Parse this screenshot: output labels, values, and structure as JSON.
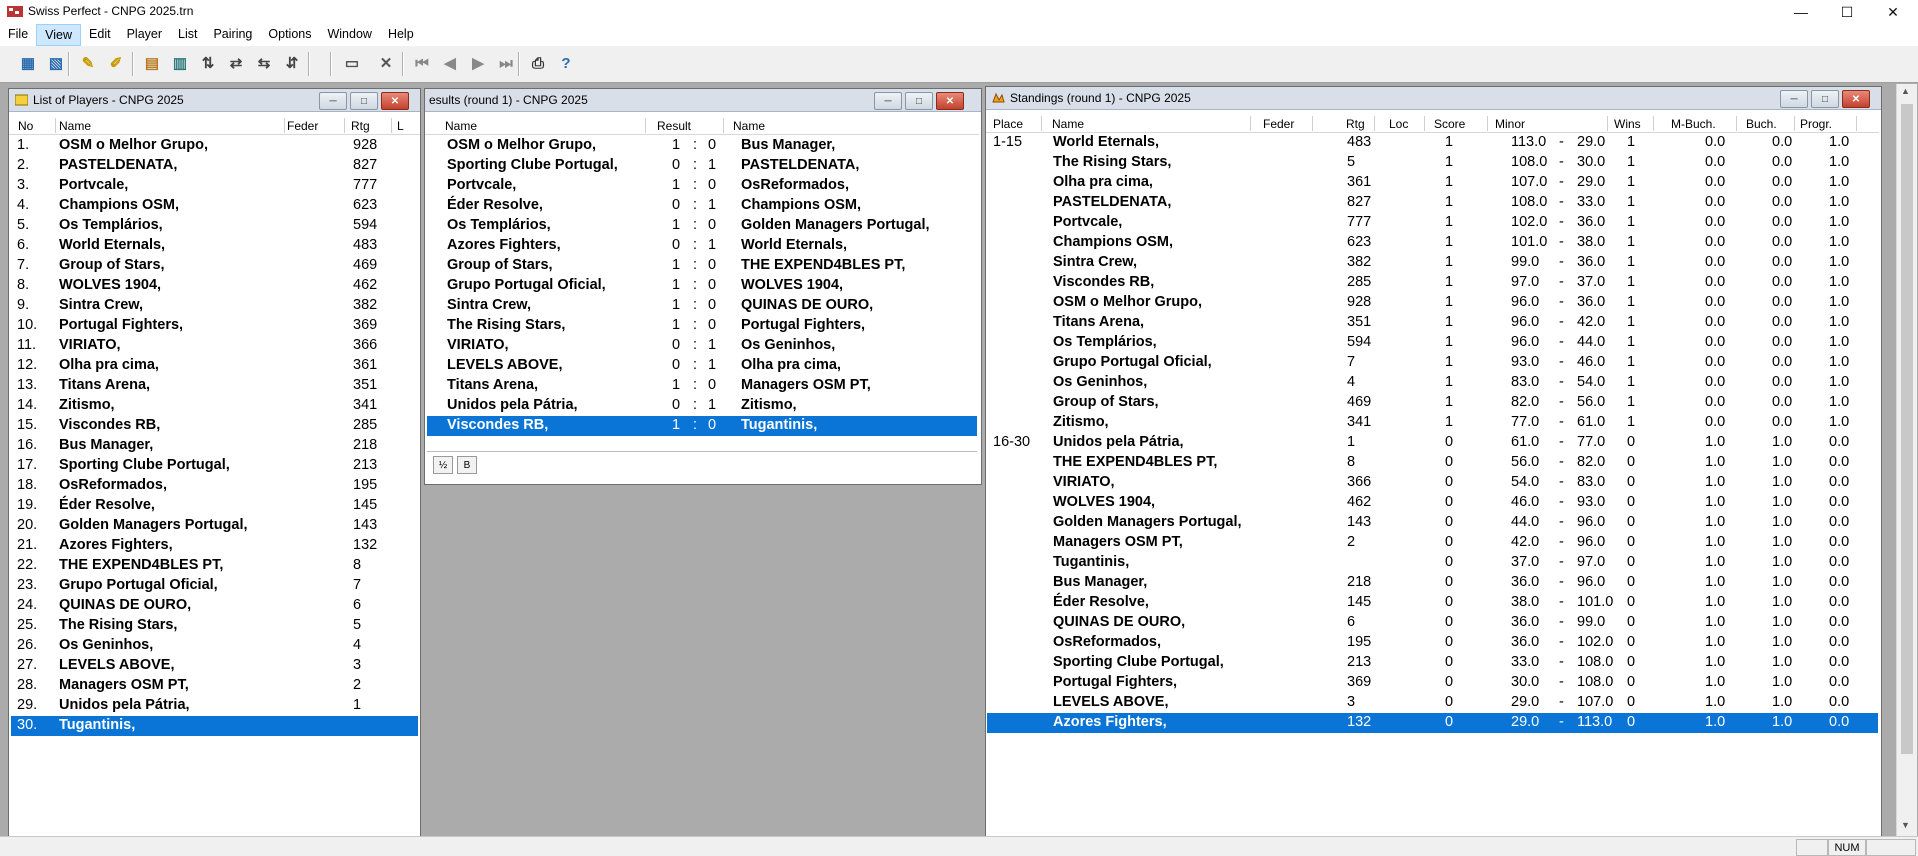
{
  "app": {
    "title": "Swiss Perfect - CNPG 2025.trn",
    "menu": [
      "File",
      "View",
      "Edit",
      "Player",
      "List",
      "Pairing",
      "Options",
      "Window",
      "Help"
    ],
    "active_menu": "View",
    "toolbar_icons": [
      "new-tournament-icon",
      "open-tournament-icon",
      "edit-player-icon",
      "withdraw-player-icon",
      "player-list-icon",
      "standings-icon",
      "round-icon",
      "pair-icon",
      "swap-icon",
      "numbering-icon",
      "crosstable-icon",
      "report-icon",
      "tie-break-icon",
      "delete-pairing-icon",
      "first-round-icon",
      "previous-round-icon",
      "next-round-icon",
      "last-round-icon",
      "print-icon",
      "help-icon"
    ],
    "accent": "#0a75d6"
  },
  "players_window": {
    "title": "List of Players - CNPG 2025",
    "headers": {
      "no": "No",
      "name": "Name",
      "feder": "Feder",
      "rtg": "Rtg",
      "l": "L"
    },
    "rows": [
      {
        "no": "1.",
        "name": "OSM o Melhor Grupo,",
        "rtg": "928"
      },
      {
        "no": "2.",
        "name": "PASTELDENATA,",
        "rtg": "827"
      },
      {
        "no": "3.",
        "name": "Portvcale,",
        "rtg": "777"
      },
      {
        "no": "4.",
        "name": "Champions OSM,",
        "rtg": "623"
      },
      {
        "no": "5.",
        "name": "Os Templários,",
        "rtg": "594"
      },
      {
        "no": "6.",
        "name": "World Eternals,",
        "rtg": "483"
      },
      {
        "no": "7.",
        "name": "Group of Stars,",
        "rtg": "469"
      },
      {
        "no": "8.",
        "name": "WOLVES 1904,",
        "rtg": "462"
      },
      {
        "no": "9.",
        "name": "Sintra Crew,",
        "rtg": "382"
      },
      {
        "no": "10.",
        "name": "Portugal Fighters,",
        "rtg": "369"
      },
      {
        "no": "11.",
        "name": "VIRIATO,",
        "rtg": "366"
      },
      {
        "no": "12.",
        "name": "Olha pra cima,",
        "rtg": "361"
      },
      {
        "no": "13.",
        "name": "Titans Arena,",
        "rtg": "351"
      },
      {
        "no": "14.",
        "name": "Zitismo,",
        "rtg": "341"
      },
      {
        "no": "15.",
        "name": "Viscondes RB,",
        "rtg": "285"
      },
      {
        "no": "16.",
        "name": "Bus Manager,",
        "rtg": "218"
      },
      {
        "no": "17.",
        "name": "Sporting Clube Portugal,",
        "rtg": "213"
      },
      {
        "no": "18.",
        "name": "OsReformados,",
        "rtg": "195"
      },
      {
        "no": "19.",
        "name": "Éder Resolve,",
        "rtg": "145"
      },
      {
        "no": "20.",
        "name": "Golden Managers Portugal,",
        "rtg": "143"
      },
      {
        "no": "21.",
        "name": "Azores Fighters,",
        "rtg": "132"
      },
      {
        "no": "22.",
        "name": "THE EXPEND4BLES PT,",
        "rtg": "8"
      },
      {
        "no": "23.",
        "name": "Grupo Portugal Oficial,",
        "rtg": "7"
      },
      {
        "no": "24.",
        "name": "QUINAS DE OURO,",
        "rtg": "6"
      },
      {
        "no": "25.",
        "name": "The Rising Stars,",
        "rtg": "5"
      },
      {
        "no": "26.",
        "name": "Os Geninhos,",
        "rtg": "4"
      },
      {
        "no": "27.",
        "name": "LEVELS ABOVE,",
        "rtg": "3"
      },
      {
        "no": "28.",
        "name": "Managers OSM PT,",
        "rtg": "2"
      },
      {
        "no": "29.",
        "name": "Unidos pela Pátria,",
        "rtg": "1"
      },
      {
        "no": "30.",
        "name": "Tugantinis,",
        "rtg": ""
      }
    ]
  },
  "results_window": {
    "title": "esults  (round 1) - CNPG 2025",
    "headers": {
      "name": "Name",
      "result": "Result",
      "name2": "Name"
    },
    "rows": [
      {
        "white": "OSM o Melhor Grupo,",
        "w": "1",
        "sep": ":",
        "b": "0",
        "black": "Bus Manager,"
      },
      {
        "white": "Sporting Clube Portugal,",
        "w": "0",
        "sep": ":",
        "b": "1",
        "black": "PASTELDENATA,"
      },
      {
        "white": "Portvcale,",
        "w": "1",
        "sep": ":",
        "b": "0",
        "black": "OsReformados,"
      },
      {
        "white": "Éder Resolve,",
        "w": "0",
        "sep": ":",
        "b": "1",
        "black": "Champions OSM,"
      },
      {
        "white": "Os Templários,",
        "w": "1",
        "sep": ":",
        "b": "0",
        "black": "Golden Managers Portugal,"
      },
      {
        "white": "Azores Fighters,",
        "w": "0",
        "sep": ":",
        "b": "1",
        "black": "World Eternals,"
      },
      {
        "white": "Group of Stars,",
        "w": "1",
        "sep": ":",
        "b": "0",
        "black": "THE EXPEND4BLES PT,"
      },
      {
        "white": "Grupo Portugal Oficial,",
        "w": "1",
        "sep": ":",
        "b": "0",
        "black": "WOLVES 1904,"
      },
      {
        "white": "Sintra Crew,",
        "w": "1",
        "sep": ":",
        "b": "0",
        "black": "QUINAS DE OURO,"
      },
      {
        "white": "The Rising Stars,",
        "w": "1",
        "sep": ":",
        "b": "0",
        "black": "Portugal Fighters,"
      },
      {
        "white": "VIRIATO,",
        "w": "0",
        "sep": ":",
        "b": "1",
        "black": "Os Geninhos,"
      },
      {
        "white": "LEVELS ABOVE,",
        "w": "0",
        "sep": ":",
        "b": "1",
        "black": "Olha pra cima,"
      },
      {
        "white": "Titans Arena,",
        "w": "1",
        "sep": ":",
        "b": "0",
        "black": "Managers OSM PT,"
      },
      {
        "white": "Unidos pela Pátria,",
        "w": "0",
        "sep": ":",
        "b": "1",
        "black": "Zitismo,"
      },
      {
        "white": "Viscondes RB,",
        "w": "1",
        "sep": ":",
        "b": "0",
        "black": "Tugantinis,"
      }
    ],
    "footer_buttons": [
      "½",
      "B"
    ]
  },
  "standings_window": {
    "title": "Standings  (round 1) - CNPG 2025",
    "headers": {
      "place": "Place",
      "name": "Name",
      "feder": "Feder",
      "rtg": "Rtg",
      "loc": "Loc",
      "score": "Score",
      "minor": "Minor",
      "wins": "Wins",
      "mbuch": "M-Buch.",
      "buch": "Buch.",
      "progr": "Progr."
    },
    "rows": [
      {
        "place": "1-15",
        "name": "World Eternals,",
        "rtg": "483",
        "score": "1",
        "mi1": "113.0",
        "mi2": "29.0",
        "wins": "1",
        "mbuch": "0.0",
        "buch": "0.0",
        "progr": "1.0"
      },
      {
        "place": "",
        "name": "The Rising Stars,",
        "rtg": "5",
        "score": "1",
        "mi1": "108.0",
        "mi2": "30.0",
        "wins": "1",
        "mbuch": "0.0",
        "buch": "0.0",
        "progr": "1.0"
      },
      {
        "place": "",
        "name": "Olha pra cima,",
        "rtg": "361",
        "score": "1",
        "mi1": "107.0",
        "mi2": "29.0",
        "wins": "1",
        "mbuch": "0.0",
        "buch": "0.0",
        "progr": "1.0"
      },
      {
        "place": "",
        "name": "PASTELDENATA,",
        "rtg": "827",
        "score": "1",
        "mi1": "108.0",
        "mi2": "33.0",
        "wins": "1",
        "mbuch": "0.0",
        "buch": "0.0",
        "progr": "1.0"
      },
      {
        "place": "",
        "name": "Portvcale,",
        "rtg": "777",
        "score": "1",
        "mi1": "102.0",
        "mi2": "36.0",
        "wins": "1",
        "mbuch": "0.0",
        "buch": "0.0",
        "progr": "1.0"
      },
      {
        "place": "",
        "name": "Champions OSM,",
        "rtg": "623",
        "score": "1",
        "mi1": "101.0",
        "mi2": "38.0",
        "wins": "1",
        "mbuch": "0.0",
        "buch": "0.0",
        "progr": "1.0"
      },
      {
        "place": "",
        "name": "Sintra Crew,",
        "rtg": "382",
        "score": "1",
        "mi1": "99.0",
        "mi2": "36.0",
        "wins": "1",
        "mbuch": "0.0",
        "buch": "0.0",
        "progr": "1.0"
      },
      {
        "place": "",
        "name": "Viscondes RB,",
        "rtg": "285",
        "score": "1",
        "mi1": "97.0",
        "mi2": "37.0",
        "wins": "1",
        "mbuch": "0.0",
        "buch": "0.0",
        "progr": "1.0"
      },
      {
        "place": "",
        "name": "OSM o Melhor Grupo,",
        "rtg": "928",
        "score": "1",
        "mi1": "96.0",
        "mi2": "36.0",
        "wins": "1",
        "mbuch": "0.0",
        "buch": "0.0",
        "progr": "1.0"
      },
      {
        "place": "",
        "name": "Titans Arena,",
        "rtg": "351",
        "score": "1",
        "mi1": "96.0",
        "mi2": "42.0",
        "wins": "1",
        "mbuch": "0.0",
        "buch": "0.0",
        "progr": "1.0"
      },
      {
        "place": "",
        "name": "Os Templários,",
        "rtg": "594",
        "score": "1",
        "mi1": "96.0",
        "mi2": "44.0",
        "wins": "1",
        "mbuch": "0.0",
        "buch": "0.0",
        "progr": "1.0"
      },
      {
        "place": "",
        "name": "Grupo Portugal Oficial,",
        "rtg": "7",
        "score": "1",
        "mi1": "93.0",
        "mi2": "46.0",
        "wins": "1",
        "mbuch": "0.0",
        "buch": "0.0",
        "progr": "1.0"
      },
      {
        "place": "",
        "name": "Os Geninhos,",
        "rtg": "4",
        "score": "1",
        "mi1": "83.0",
        "mi2": "54.0",
        "wins": "1",
        "mbuch": "0.0",
        "buch": "0.0",
        "progr": "1.0"
      },
      {
        "place": "",
        "name": "Group of Stars,",
        "rtg": "469",
        "score": "1",
        "mi1": "82.0",
        "mi2": "56.0",
        "wins": "1",
        "mbuch": "0.0",
        "buch": "0.0",
        "progr": "1.0"
      },
      {
        "place": "",
        "name": "Zitismo,",
        "rtg": "341",
        "score": "1",
        "mi1": "77.0",
        "mi2": "61.0",
        "wins": "1",
        "mbuch": "0.0",
        "buch": "0.0",
        "progr": "1.0"
      },
      {
        "place": "16-30",
        "name": "Unidos pela Pátria,",
        "rtg": "1",
        "score": "0",
        "mi1": "61.0",
        "mi2": "77.0",
        "wins": "0",
        "mbuch": "1.0",
        "buch": "1.0",
        "progr": "0.0"
      },
      {
        "place": "",
        "name": "THE EXPEND4BLES PT,",
        "rtg": "8",
        "score": "0",
        "mi1": "56.0",
        "mi2": "82.0",
        "wins": "0",
        "mbuch": "1.0",
        "buch": "1.0",
        "progr": "0.0"
      },
      {
        "place": "",
        "name": "VIRIATO,",
        "rtg": "366",
        "score": "0",
        "mi1": "54.0",
        "mi2": "83.0",
        "wins": "0",
        "mbuch": "1.0",
        "buch": "1.0",
        "progr": "0.0"
      },
      {
        "place": "",
        "name": "WOLVES 1904,",
        "rtg": "462",
        "score": "0",
        "mi1": "46.0",
        "mi2": "93.0",
        "wins": "0",
        "mbuch": "1.0",
        "buch": "1.0",
        "progr": "0.0"
      },
      {
        "place": "",
        "name": "Golden Managers Portugal,",
        "rtg": "143",
        "score": "0",
        "mi1": "44.0",
        "mi2": "96.0",
        "wins": "0",
        "mbuch": "1.0",
        "buch": "1.0",
        "progr": "0.0"
      },
      {
        "place": "",
        "name": "Managers OSM PT,",
        "rtg": "2",
        "score": "0",
        "mi1": "42.0",
        "mi2": "96.0",
        "wins": "0",
        "mbuch": "1.0",
        "buch": "1.0",
        "progr": "0.0"
      },
      {
        "place": "",
        "name": "Tugantinis,",
        "rtg": "",
        "score": "0",
        "mi1": "37.0",
        "mi2": "97.0",
        "wins": "0",
        "mbuch": "1.0",
        "buch": "1.0",
        "progr": "0.0"
      },
      {
        "place": "",
        "name": "Bus Manager,",
        "rtg": "218",
        "score": "0",
        "mi1": "36.0",
        "mi2": "96.0",
        "wins": "0",
        "mbuch": "1.0",
        "buch": "1.0",
        "progr": "0.0"
      },
      {
        "place": "",
        "name": "Éder Resolve,",
        "rtg": "145",
        "score": "0",
        "mi1": "38.0",
        "mi2": "101.0",
        "wins": "0",
        "mbuch": "1.0",
        "buch": "1.0",
        "progr": "0.0"
      },
      {
        "place": "",
        "name": "QUINAS DE OURO,",
        "rtg": "6",
        "score": "0",
        "mi1": "36.0",
        "mi2": "99.0",
        "wins": "0",
        "mbuch": "1.0",
        "buch": "1.0",
        "progr": "0.0"
      },
      {
        "place": "",
        "name": "OsReformados,",
        "rtg": "195",
        "score": "0",
        "mi1": "36.0",
        "mi2": "102.0",
        "wins": "0",
        "mbuch": "1.0",
        "buch": "1.0",
        "progr": "0.0"
      },
      {
        "place": "",
        "name": "Sporting Clube Portugal,",
        "rtg": "213",
        "score": "0",
        "mi1": "33.0",
        "mi2": "108.0",
        "wins": "0",
        "mbuch": "1.0",
        "buch": "1.0",
        "progr": "0.0"
      },
      {
        "place": "",
        "name": "Portugal Fighters,",
        "rtg": "369",
        "score": "0",
        "mi1": "30.0",
        "mi2": "108.0",
        "wins": "0",
        "mbuch": "1.0",
        "buch": "1.0",
        "progr": "0.0"
      },
      {
        "place": "",
        "name": "LEVELS ABOVE,",
        "rtg": "3",
        "score": "0",
        "mi1": "29.0",
        "mi2": "107.0",
        "wins": "0",
        "mbuch": "1.0",
        "buch": "1.0",
        "progr": "0.0"
      },
      {
        "place": "",
        "name": "Azores Fighters,",
        "rtg": "132",
        "score": "0",
        "mi1": "29.0",
        "mi2": "113.0",
        "wins": "0",
        "mbuch": "1.0",
        "buch": "1.0",
        "progr": "0.0"
      }
    ]
  },
  "status_bar": {
    "num": "NUM"
  }
}
